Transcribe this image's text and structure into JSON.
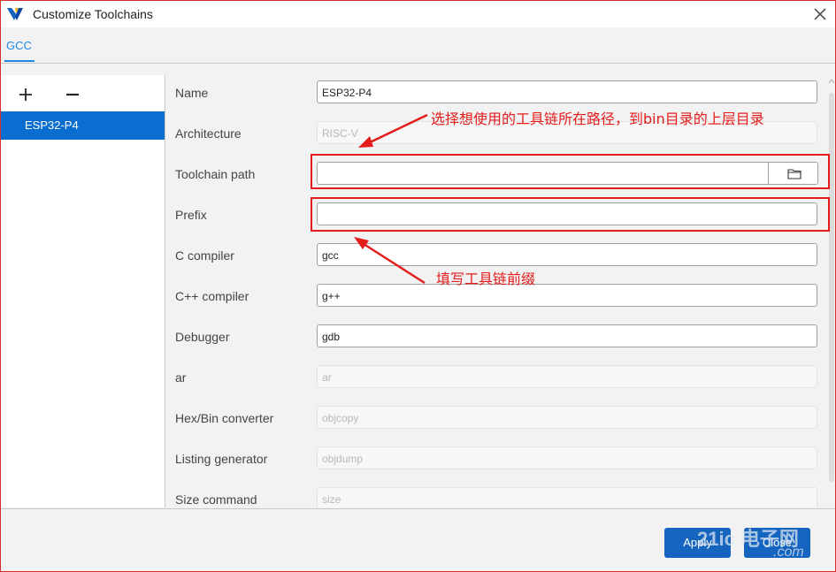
{
  "window": {
    "title": "Customize Toolchains",
    "close_icon": "close-icon",
    "app_icon": "app-logo-icon"
  },
  "tabs": [
    {
      "label": "GCC",
      "active": true
    }
  ],
  "toolchain_list": {
    "add_icon": "plus-icon",
    "remove_icon": "minus-icon",
    "items": [
      {
        "label": "ESP32-P4",
        "selected": true
      }
    ]
  },
  "form": {
    "name": {
      "label": "Name",
      "value": "ESP32-P4"
    },
    "architecture": {
      "label": "Architecture",
      "value": "RISC-V"
    },
    "toolchain_path": {
      "label": "Toolchain path",
      "value": "",
      "browse_icon": "folder-icon"
    },
    "prefix": {
      "label": "Prefix",
      "value": ""
    },
    "c_compiler": {
      "label": "C compiler",
      "value": "gcc"
    },
    "cpp_compiler": {
      "label": "C++ compiler",
      "value": "g++"
    },
    "debugger": {
      "label": "Debugger",
      "value": "gdb"
    },
    "ar": {
      "label": "ar",
      "value": "ar"
    },
    "hexbin": {
      "label": "Hex/Bin converter",
      "value": "objcopy"
    },
    "listing": {
      "label": "Listing generator",
      "value": "objdump"
    },
    "size": {
      "label": "Size command",
      "value": "size"
    }
  },
  "annotations": {
    "path_note": "选择想使用的工具链所在路径，到bin目录的上层目录",
    "prefix_note": "填写工具链前缀"
  },
  "footer": {
    "apply_label": "Apply",
    "close_label": "Close"
  },
  "watermark": {
    "text": "21ic 电子网",
    "domain": ".com"
  },
  "colors": {
    "accent": "#1e88e5",
    "selection": "#0a6ed1",
    "button": "#1565c0",
    "annotation": "#e31c1c"
  }
}
